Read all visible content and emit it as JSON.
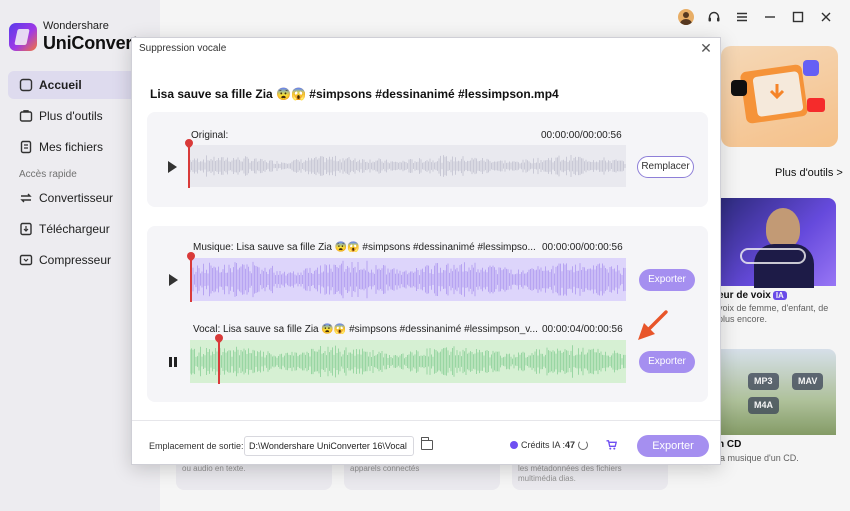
{
  "app": {
    "brand": "Wondershare",
    "product": "UniConverter",
    "nav": [
      {
        "label": "Accueil",
        "icon": "home-icon",
        "active": true
      },
      {
        "label": "Plus d'outils",
        "icon": "tools-icon"
      },
      {
        "label": "Mes fichiers",
        "icon": "files-icon"
      }
    ],
    "section_label": "Accès rapide",
    "quick": [
      {
        "label": "Convertisseur",
        "icon": "convert-icon"
      },
      {
        "label": "Téléchargeur",
        "icon": "download-icon"
      },
      {
        "label": "Compresseur",
        "icon": "compress-icon"
      }
    ],
    "more_tools": "Plus d'outils >",
    "card_voice": {
      "title": "eur de voix",
      "badge": "IA",
      "desc": "voix de femme, d'enfant, de plus encore."
    },
    "card_cd": {
      "title": "n CD",
      "desc": "la musique d'un CD.",
      "chips": [
        "MP3",
        "MAV",
        "M4A"
      ]
    },
    "bottom_cards": [
      "ou audio en texte.",
      "apparels connectés",
      "les métadonnées des fichiers multimédia dias."
    ]
  },
  "dialog": {
    "title": "Suppression vocale",
    "file_name": "Lisa sauve sa fille Zia 😨😱 #simpsons #dessinanimé #lessimpson.mp4",
    "original": {
      "label": "Original:",
      "time": "00:00:00/00:00:56",
      "replace_label": "Remplacer",
      "wave_color": "#c9c9d6"
    },
    "music": {
      "label": "Musique: Lisa sauve sa fille Zia 😨😱 #simpsons #dessinanimé #lessimpso...",
      "time": "00:00:00/00:00:56",
      "export_label": "Exporter",
      "wave_color": "#b7a4f2"
    },
    "vocal": {
      "label": "Vocal: Lisa sauve sa fille Zia 😨😱 #simpsons #dessinanimé #lessimpson_v...",
      "time": "00:00:04/00:00:56",
      "export_label": "Exporter",
      "wave_color": "#99d6a3",
      "playing": true
    },
    "footer": {
      "output_label": "Emplacement de sortie:",
      "output_path": "D:\\Wondershare UniConverter 16\\Vocal",
      "credits_label": "Crédits IA :",
      "credits_value": "47",
      "export_label": "Exporter"
    }
  },
  "colors": {
    "accent": "#a58ff0",
    "playhead": "#d93a3a",
    "hint_arrow": "#e8552a"
  }
}
